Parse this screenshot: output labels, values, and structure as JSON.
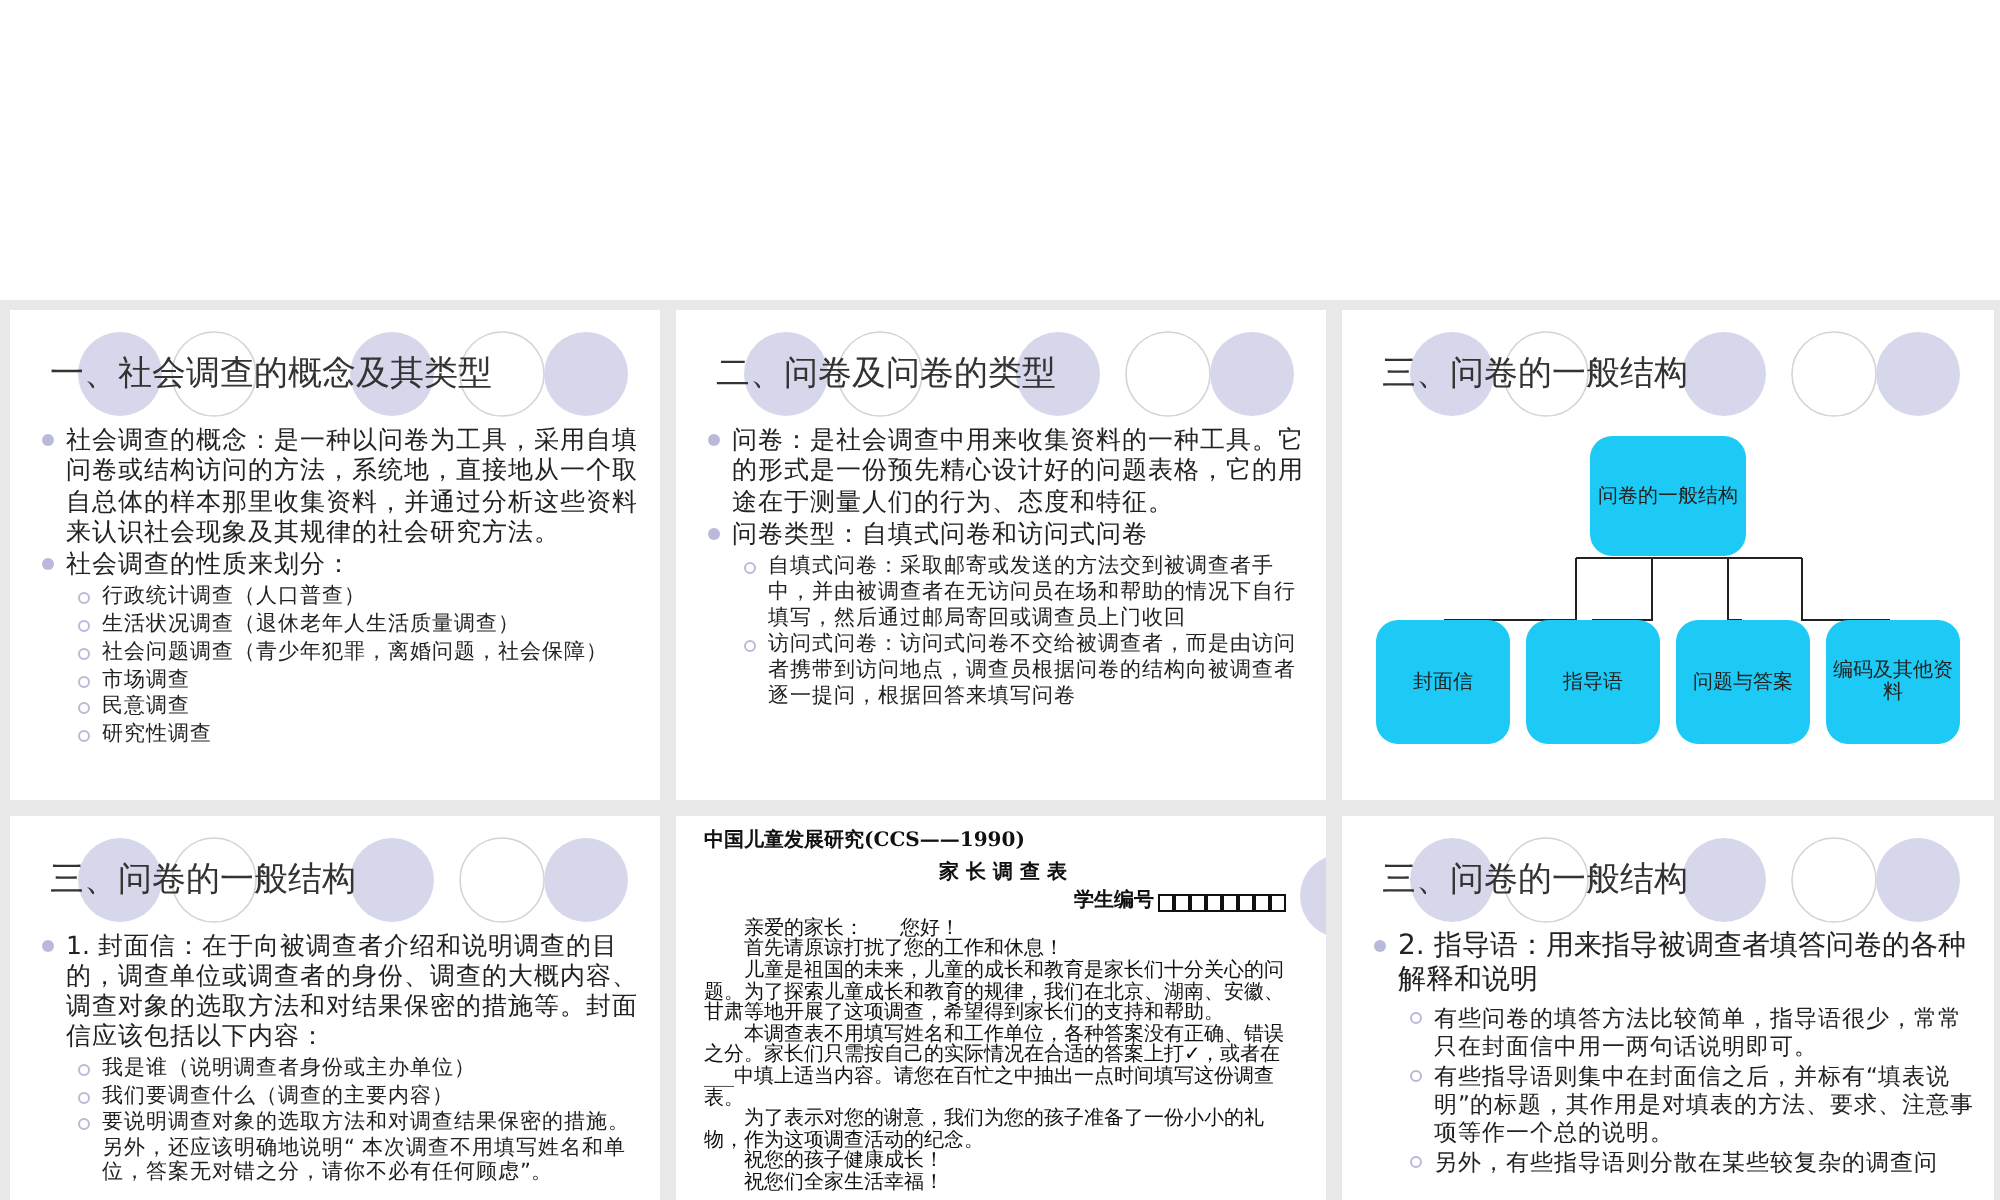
{
  "slides": [
    {
      "kind": "bullets",
      "title": "一、社会调查的概念及其类型",
      "bullets": [
        {
          "text": "社会调查的概念：是一种以问卷为工具，采用自填问卷或结构访问的方法，系统地，直接地从一个取自总体的样本那里收集资料，并通过分析这些资料来认识社会现象及其规律的社会研究方法。"
        },
        {
          "text": "社会调查的性质来划分：",
          "children": [
            {
              "text": "行政统计调查（人口普查）"
            },
            {
              "text": "生活状况调查（退休老年人生活质量调查）"
            },
            {
              "text": "社会问题调查（青少年犯罪，离婚问题，社会保障）"
            },
            {
              "text": "市场调查"
            },
            {
              "text": "民意调查"
            },
            {
              "text": "研究性调查"
            }
          ]
        }
      ]
    },
    {
      "kind": "bullets",
      "title": "二、问卷及问卷的类型",
      "bullets": [
        {
          "text": "问卷：是社会调查中用来收集资料的一种工具。它的形式是一份预先精心设计好的问题表格，它的用途在于测量人们的行为、态度和特征。"
        },
        {
          "text": "问卷类型：自填式问卷和访问式问卷",
          "children": [
            {
              "text": "自填式问卷：采取邮寄或发送的方法交到被调查者手中，并由被调查者在无访问员在场和帮助的情况下自行填写，然后通过邮局寄回或调查员上门收回"
            },
            {
              "text": "访问式问卷：访问式问卷不交给被调查者，而是由访问者携带到访问地点，调查员根据问卷的结构向被调查者逐一提问，根据回答来填写问卷"
            }
          ]
        }
      ]
    },
    {
      "kind": "diagram",
      "title": "三、问卷的一般结构",
      "root": {
        "label": "问卷的一般结构",
        "children": [
          {
            "label": "封面信"
          },
          {
            "label": "指导语"
          },
          {
            "label": "问题与答案"
          },
          {
            "label": "编码及其他资料"
          }
        ]
      }
    },
    {
      "kind": "bullets",
      "title": "三、问卷的一般结构",
      "bullets": [
        {
          "text": "1. 封面信：在于向被调查者介绍和说明调查的目的，调查单位或调查者的身份、调查的大概内容、调查对象的选取方法和对结果保密的措施等。封面信应该包括以下内容：",
          "children": [
            {
              "text": "我是谁（说明调查者身份或主办单位）"
            },
            {
              "text": "我们要调查什么（调查的主要内容）"
            },
            {
              "text": "要说明调查对象的选取方法和对调查结果保密的措施。另外，还应该明确地说明“ 本次调查不用填写姓名和单位，答案无对错之分，请你不必有任何顾虑”。"
            }
          ]
        }
      ]
    },
    {
      "kind": "document",
      "header": "中国儿童发展研究(CCS——1990)",
      "title": "家 长 调 查 表",
      "number_label": "学生编号",
      "greeting": [
        "亲爱的家长：",
        "您好！"
      ],
      "paragraphs": [
        "首先请原谅打扰了您的工作和休息！",
        "儿童是祖国的未来，儿童的成长和教育是家长们十分关心的问题。为了探索儿童成长和教育的规律，我们在北京、湖南、安徽、甘肃等地开展了这项调查，希望得到家长们的支持和帮助。",
        "本调查表不用填写姓名和工作单位，各种答案没有正确、错误之分。家长们只需按自己的实际情况在合适的答案上打✓，或者在___中填上适当内容。请您在百忙之中抽出一点时间填写这份调查表。",
        "为了表示对您的谢意，我们为您的孩子准备了一份小小的礼物，作为这项调查活动的纪念。",
        "祝您的孩子健康成长！",
        "祝您们全家生活幸福！"
      ]
    },
    {
      "kind": "bullets",
      "title": "三、问卷的一般结构",
      "bullets": [
        {
          "text": "2. 指导语：用来指导被调查者填答问卷的各种解释和说明",
          "children": [
            {
              "text": "有些问卷的填答方法比较简单，指导语很少，常常只在封面信中用一两句话说明即可。"
            },
            {
              "text": "有些指导语则集中在封面信之后，并标有“填表说明”的标题，其作用是对填表的方法、要求、注意事项等作一个总的说明。"
            },
            {
              "text": "另外，有些指导语则分散在某些较复杂的调查问"
            }
          ]
        }
      ]
    }
  ]
}
